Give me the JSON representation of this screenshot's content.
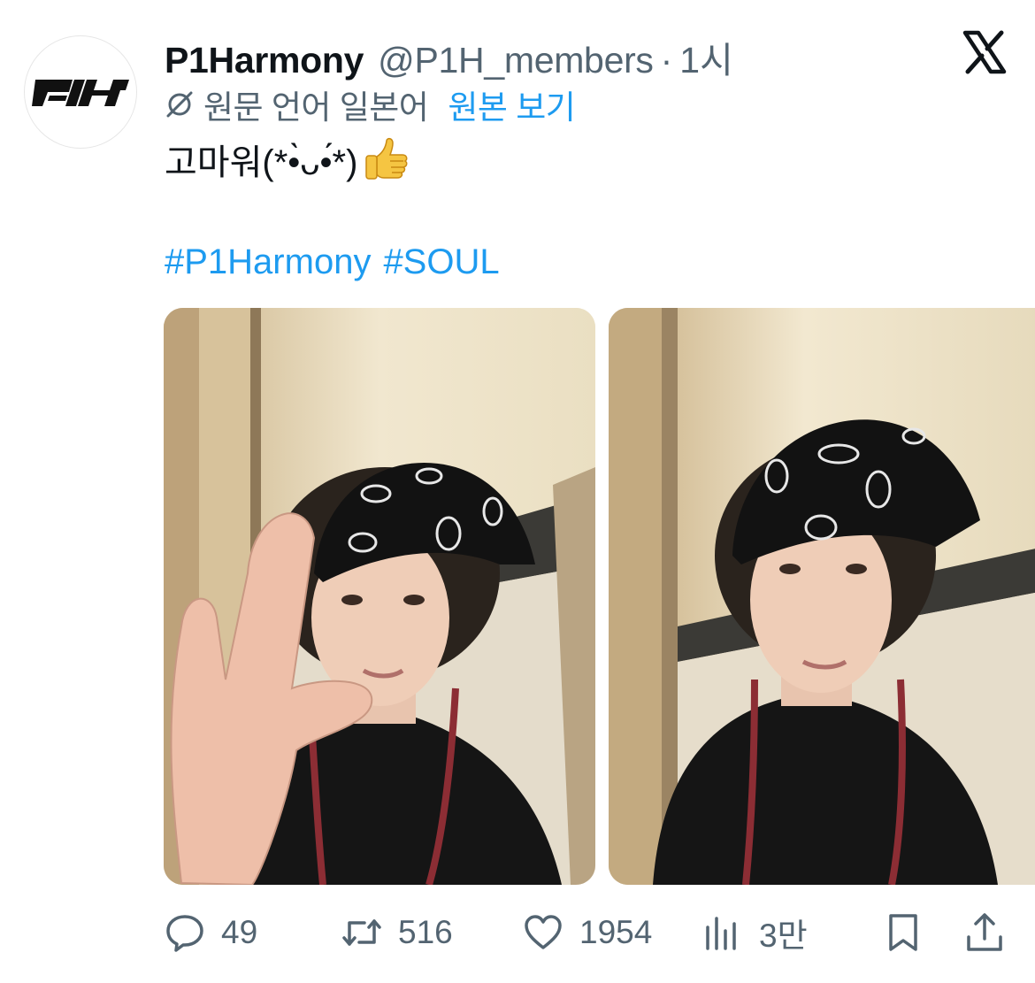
{
  "colors": {
    "text_primary": "#0f1419",
    "text_secondary": "#536471",
    "link_blue": "#1d9bf0",
    "background": "#ffffff"
  },
  "tweet": {
    "author": {
      "display_name": "P1Harmony",
      "handle": "@P1H_members",
      "separator": "·",
      "time_ago": "1시",
      "avatar_icon": "p1h-logo-icon"
    },
    "platform_icon": "x-logo-icon",
    "translation": {
      "icon": "globe-off-icon",
      "note": "원문 언어 일본어",
      "show_original_link": "원본 보기"
    },
    "text": "고마워(*•̀ᴗ•́*)",
    "text_emoji": "thumbs-up-emoji",
    "hashtags": [
      "#P1Harmony",
      "#SOUL"
    ],
    "media": [
      {
        "kind": "photo",
        "subject": "selfie-peace-sign"
      },
      {
        "kind": "photo",
        "subject": "selfie-bandana"
      }
    ],
    "actions": {
      "replies": "49",
      "retweets": "516",
      "likes": "1954",
      "views": "3만"
    }
  }
}
